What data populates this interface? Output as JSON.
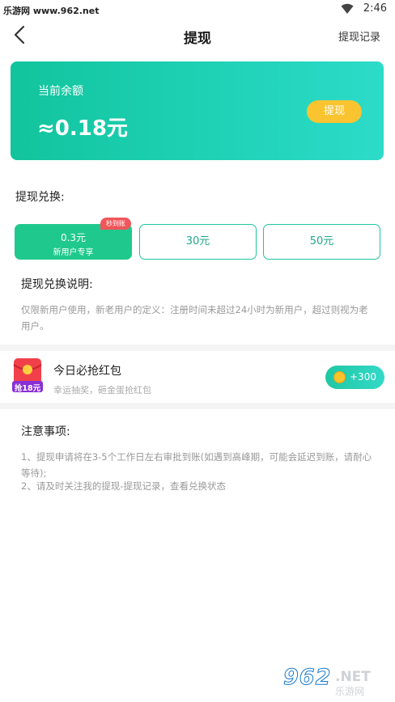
{
  "status_bar": {
    "site": "乐游网 www.962.net",
    "time": "2:46"
  },
  "nav": {
    "title": "提现",
    "record": "提现记录"
  },
  "balance": {
    "label": "当前余额",
    "value": "≈0.18元",
    "button": "提现"
  },
  "exchange": {
    "title": "提现兑换:",
    "badge": "秒到账",
    "options": [
      {
        "value": "0.3元",
        "sub": "新用户专享",
        "selected": true
      },
      {
        "value": "30元"
      },
      {
        "value": "50元"
      }
    ]
  },
  "explain": {
    "title": "提现兑换说明:",
    "text": "仅限新用户使用，新老用户的定义：注册时间未超过24小时为新用户，超过则视为老用户。"
  },
  "red_packet": {
    "icon_label": "抢18元",
    "title": "今日必抢红包",
    "subtitle": "幸运抽奖，砸金蛋抢红包",
    "button": "+300"
  },
  "notes": {
    "title": "注意事项:",
    "line1": "1、提现申请将在3-5个工作日左右审批到账(如遇到高峰期，可能会延迟到账，请耐心等待);",
    "line2": "2、请及时关注我的提现-提现记录，查看兑换状态"
  },
  "watermark": {
    "num": "962",
    "net": ".NET",
    "cn": "乐游网"
  },
  "colors": {
    "accent": "#1fc59f",
    "button_yellow": "#f9c430",
    "badge_red": "#f0565a"
  }
}
